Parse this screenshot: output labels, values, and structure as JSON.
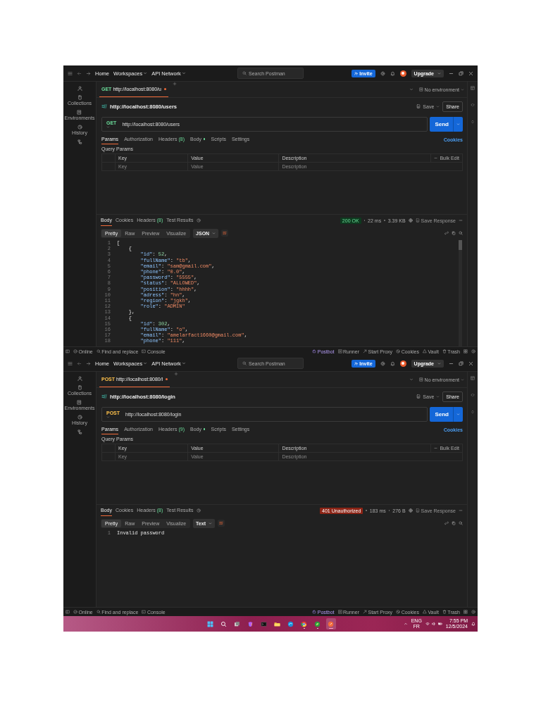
{
  "windows": [
    {
      "titlebar": {
        "nav": [
          {
            "label": "Home",
            "dropdown": false
          },
          {
            "label": "Workspaces",
            "dropdown": true
          },
          {
            "label": "API Network",
            "dropdown": true
          }
        ],
        "search": {
          "placeholder": "Search Postman"
        },
        "invite": "Invite",
        "upgrade": "Upgrade"
      },
      "sidebar": {
        "items": [
          {
            "label": "Collections"
          },
          {
            "label": "Environments"
          },
          {
            "label": "History"
          }
        ]
      },
      "tab": {
        "method": "GET",
        "kind": "get",
        "title": "http://localhost:8080/u",
        "unsaved": true,
        "selected": true
      },
      "environment": "No environment",
      "request": {
        "title": "http://localhost:8080/users",
        "save": "Save",
        "share": "Share",
        "method": "GET",
        "kind": "get",
        "url": "http://localhost:8080/users",
        "send": "Send"
      },
      "request_tabs": [
        {
          "label": "Params",
          "selected": true,
          "indicator": false
        },
        {
          "label": "Authorization",
          "selected": false,
          "indicator": false
        },
        {
          "label": "Headers",
          "count": "(8)",
          "selected": false,
          "indicator": false
        },
        {
          "label": "Body",
          "selected": false,
          "indicator": true
        },
        {
          "label": "Scripts",
          "selected": false,
          "indicator": false
        },
        {
          "label": "Settings",
          "selected": false,
          "indicator": false
        }
      ],
      "cookies": "Cookies",
      "query_params": "Query Params",
      "params_table": {
        "columns": [
          "Key",
          "Value",
          "Description"
        ],
        "bulk_edit": "Bulk Edit",
        "placeholders": [
          "Key",
          "Value",
          "Description"
        ]
      },
      "response_tabs": [
        {
          "label": "Body",
          "selected": true
        },
        {
          "label": "Cookies",
          "selected": false
        },
        {
          "label": "Headers",
          "count": "(8)",
          "selected": false
        },
        {
          "label": "Test Results",
          "selected": false
        }
      ],
      "response": {
        "status": "200 OK",
        "kind": "success",
        "time": "22 ms",
        "size": "3.39 KB",
        "save_response": "Save Response"
      },
      "view_modes": [
        {
          "label": "Pretty",
          "selected": true
        },
        {
          "label": "Raw",
          "selected": false
        },
        {
          "label": "Preview",
          "selected": false
        },
        {
          "label": "Visualize",
          "selected": false
        }
      ],
      "format": "JSON",
      "code_lines": [
        {
          "num": "1",
          "text": "["
        },
        {
          "num": "2",
          "text": "    {"
        },
        {
          "num": "3",
          "text": "        \"id\": 52,"
        },
        {
          "num": "4",
          "text": "        \"fullName\": \"tb\","
        },
        {
          "num": "5",
          "text": "        \"email\": \"sam@gmail.com\","
        },
        {
          "num": "6",
          "text": "        \"phone\": \"0.0\","
        },
        {
          "num": "7",
          "text": "        \"password\": \"5555\","
        },
        {
          "num": "8",
          "text": "        \"status\": \"ALLOWED\","
        },
        {
          "num": "9",
          "text": "        \"position\": \"hhhh\","
        },
        {
          "num": "10",
          "text": "        \"adress\": \"hn\","
        },
        {
          "num": "11",
          "text": "        \"region\": \"jgkh\","
        },
        {
          "num": "12",
          "text": "        \"role\": \"ADMIN\""
        },
        {
          "num": "13",
          "text": "    },"
        },
        {
          "num": "14",
          "text": "    {"
        },
        {
          "num": "15",
          "text": "        \"id\": 302,"
        },
        {
          "num": "16",
          "text": "        \"fullName\": \"o\","
        },
        {
          "num": "17",
          "text": "        \"email\": \"amelarfact1660@gmail.com\","
        },
        {
          "num": "18",
          "text": "        \"phone\": \"111\","
        }
      ],
      "status_bar": {
        "left": [
          "Online",
          "Find and replace",
          "Console"
        ],
        "right": [
          "Postbot",
          "Runner",
          "Start Proxy",
          "Cookies",
          "Vault",
          "Trash"
        ]
      }
    },
    {
      "titlebar": {
        "nav": [
          {
            "label": "Home",
            "dropdown": false
          },
          {
            "label": "Workspaces",
            "dropdown": true
          },
          {
            "label": "API Network",
            "dropdown": true
          }
        ],
        "search": {
          "placeholder": "Search Postman"
        },
        "invite": "Invite",
        "upgrade": "Upgrade"
      },
      "sidebar": {
        "items": [
          {
            "label": "Collections"
          },
          {
            "label": "Environments"
          },
          {
            "label": "History"
          }
        ]
      },
      "tab": {
        "method": "POST",
        "kind": "post",
        "title": "http://localhost:8080/l",
        "unsaved": true,
        "selected": true
      },
      "environment": "No environment",
      "request": {
        "title": "http://localhost:8080/login",
        "save": "Save",
        "share": "Share",
        "method": "POST",
        "kind": "post",
        "url": "http://localhost:8080/login",
        "send": "Send"
      },
      "request_tabs": [
        {
          "label": "Params",
          "selected": true,
          "indicator": false
        },
        {
          "label": "Authorization",
          "selected": false,
          "indicator": false
        },
        {
          "label": "Headers",
          "count": "(9)",
          "selected": false,
          "indicator": false
        },
        {
          "label": "Body",
          "selected": false,
          "indicator": true
        },
        {
          "label": "Scripts",
          "selected": false,
          "indicator": false
        },
        {
          "label": "Settings",
          "selected": false,
          "indicator": false
        }
      ],
      "cookies": "Cookies",
      "query_params": "Query Params",
      "params_table": {
        "columns": [
          "Key",
          "Value",
          "Description"
        ],
        "bulk_edit": "Bulk Edit",
        "placeholders": [
          "Key",
          "Value",
          "Description"
        ]
      },
      "response_tabs": [
        {
          "label": "Body",
          "selected": true
        },
        {
          "label": "Cookies",
          "selected": false
        },
        {
          "label": "Headers",
          "count": "(8)",
          "selected": false
        },
        {
          "label": "Test Results",
          "selected": false
        }
      ],
      "response": {
        "status": "401 Unauthorized",
        "kind": "error",
        "time": "183 ms",
        "size": "276 B",
        "save_response": "Save Response"
      },
      "view_modes": [
        {
          "label": "Pretty",
          "selected": true
        },
        {
          "label": "Raw",
          "selected": false
        },
        {
          "label": "Preview",
          "selected": false
        },
        {
          "label": "Visualize",
          "selected": false
        }
      ],
      "format": "Text",
      "code_lines": [
        {
          "num": "1",
          "text": "Invalid password"
        }
      ],
      "status_bar": {
        "left": [
          "Online",
          "Find and replace",
          "Console"
        ],
        "right": [
          "Postbot",
          "Runner",
          "Start Proxy",
          "Cookies",
          "Vault",
          "Trash"
        ]
      }
    }
  ],
  "taskbar": {
    "apps": [
      {
        "kind": "windows",
        "running": false,
        "active": false
      },
      {
        "kind": "search",
        "running": false,
        "active": false
      },
      {
        "kind": "taskview",
        "running": false,
        "active": false
      },
      {
        "kind": "copilot",
        "running": false,
        "active": false
      },
      {
        "kind": "terminal",
        "running": false,
        "active": false
      },
      {
        "kind": "folder",
        "running": false,
        "active": false
      },
      {
        "kind": "swirl",
        "running": false,
        "active": false
      },
      {
        "kind": "browser",
        "running": true,
        "active": false
      },
      {
        "kind": "leaf",
        "running": true,
        "active": false
      },
      {
        "kind": "rocket",
        "running": true,
        "active": true
      }
    ],
    "language": "ENG",
    "layout": "FR",
    "time": "7:55 PM",
    "date": "12/5/2024"
  }
}
